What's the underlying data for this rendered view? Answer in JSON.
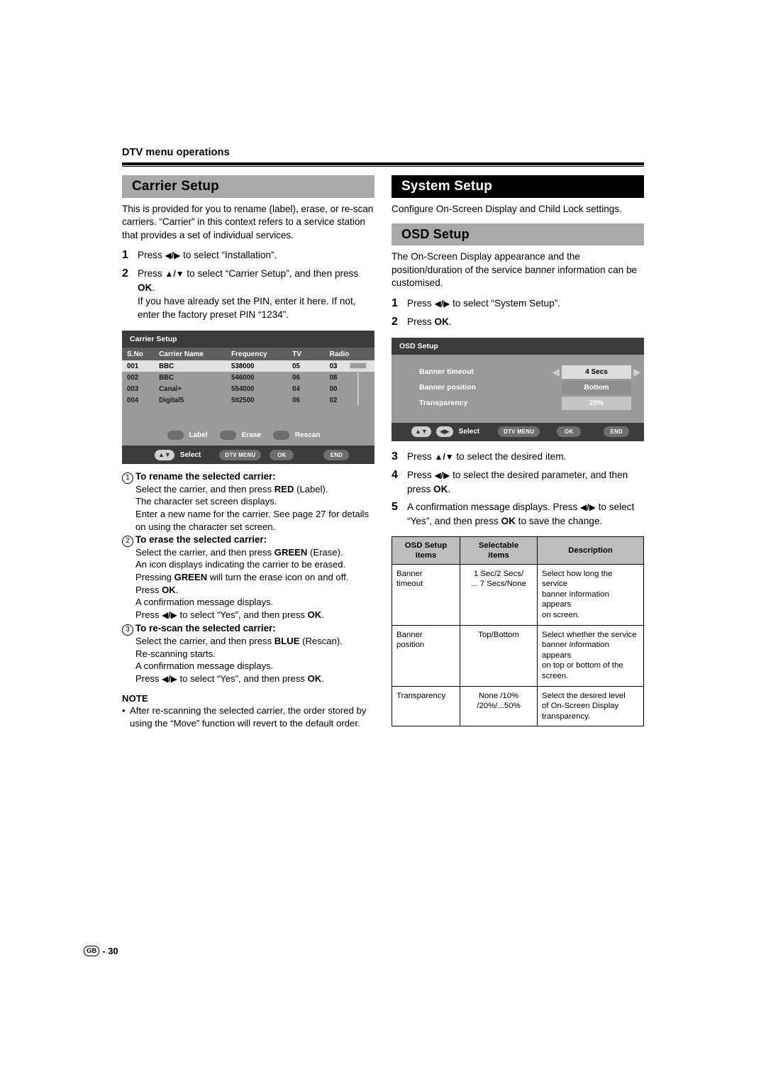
{
  "page": {
    "running_head": "DTV menu operations",
    "footer_region": "GB",
    "footer_page": "- 30"
  },
  "left_column": {
    "section_title": "Carrier Setup",
    "intro": "This is provided for you to rename (label), erase, or re-scan carriers. “Carrier” in this context refers to a service station that provides a set of individual services.",
    "steps": [
      {
        "num": "1",
        "text_before": "Press ",
        "arrows": "◀/▶",
        "text_after": " to select “Installation”."
      },
      {
        "num": "2",
        "text_before": "Press ",
        "arrows": "▲/▼",
        "text_after": " to select “Carrier Setup”, and then press OK.",
        "extra": "If you have already set the PIN, enter it here. If not, enter the factory preset PIN “1234”."
      }
    ],
    "osd": {
      "title": "Carrier Setup",
      "columns": [
        "S.No",
        "Carrier Name",
        "Frequency",
        "TV",
        "Radio"
      ],
      "rows": [
        {
          "sno": "001",
          "name": "BBC",
          "freq": "538000",
          "tv": "05",
          "radio": "03",
          "selected": true
        },
        {
          "sno": "002",
          "name": "BBC",
          "freq": "546000",
          "tv": "06",
          "radio": "08",
          "selected": false
        },
        {
          "sno": "003",
          "name": "Canal+",
          "freq": "554000",
          "tv": "04",
          "radio": "00",
          "selected": false
        },
        {
          "sno": "004",
          "name": "Digital5",
          "freq": "592500",
          "tv": "06",
          "radio": "02",
          "selected": false
        }
      ],
      "color_buttons": [
        "Label",
        "Erase",
        "Rescan"
      ],
      "footer": {
        "select": "Select",
        "dtv_menu": "DTV MENU",
        "ok": "OK",
        "end": "END"
      }
    },
    "procedures": [
      {
        "marker": "1",
        "heading": "To rename the selected carrier:",
        "lines": [
          "Select the carrier, and then press RED (Label).",
          "The character set screen displays.",
          "Enter a new name for the carrier. See page 27 for details on using the character set screen."
        ]
      },
      {
        "marker": "2",
        "heading": "To erase the selected carrier:",
        "lines": [
          "Select the carrier, and then press GREEN (Erase).",
          "An icon displays indicating the carrier to be erased.",
          "Pressing GREEN will turn the erase icon on and off.",
          "Press OK.",
          "A confirmation message displays.",
          "Press ◀/▶ to select “Yes”, and then press OK."
        ]
      },
      {
        "marker": "3",
        "heading": "To re-scan the selected carrier:",
        "lines": [
          "Select the carrier, and then press BLUE (Rescan).",
          "Re-scanning starts.",
          "A confirmation message displays.",
          "Press ◀/▶ to select “Yes”, and then press OK."
        ]
      }
    ],
    "note": {
      "heading": "NOTE",
      "bullet": "•",
      "text": "After re-scanning the selected carrier, the order stored by using the “Move” function will revert to the default order."
    }
  },
  "right_column": {
    "section_title": "System Setup",
    "section_intro": "Configure On-Screen Display and Child Lock settings.",
    "sub_title": "OSD Setup",
    "sub_intro": "The On-Screen Display appearance and the position/duration of the service banner information can be customised.",
    "steps_top": [
      {
        "num": "1",
        "text_before": "Press ",
        "arrows": "◀/▶",
        "text_after": " to select “System Setup”."
      },
      {
        "num": "2",
        "text_before": "Press OK.",
        "arrows": "",
        "text_after": ""
      }
    ],
    "osd": {
      "title": "OSD Setup",
      "rows": [
        {
          "label": "Banner timeout",
          "value": "4 Secs",
          "style": "highlight",
          "arrows": true
        },
        {
          "label": "Banner position",
          "value": "Bottom",
          "style": "mid",
          "arrows": false
        },
        {
          "label": "Transparency",
          "value": "20%",
          "style": "low",
          "arrows": false
        }
      ],
      "arrow_left": "◀",
      "arrow_right": "▶",
      "footer": {
        "select": "Select",
        "dtv_menu": "DTV MENU",
        "ok": "OK",
        "end": "END"
      }
    },
    "steps_bottom": [
      {
        "num": "3",
        "text_before": "Press ",
        "arrows": "▲/▼",
        "text_after": " to select the desired item."
      },
      {
        "num": "4",
        "text_before": "Press ",
        "arrows": "◀/▶",
        "text_after": " to select the desired parameter, and then press OK."
      },
      {
        "num": "5",
        "text_before": "A confirmation message displays. Press ",
        "arrows": "◀/▶",
        "text_after": " to select “Yes”, and then press OK to save the change."
      }
    ],
    "spec_table": {
      "headers": [
        "OSD Setup items",
        "Selectable items",
        "Description"
      ],
      "header_lines": [
        [
          "OSD Setup",
          "items"
        ],
        [
          "Selectable",
          "items"
        ],
        [
          "Description"
        ]
      ],
      "rows": [
        {
          "item": "Banner timeout",
          "item_lines": [
            "Banner",
            "timeout"
          ],
          "selectable": "1 Sec/2 Secs/ ... 7 Secs/None",
          "selectable_lines": [
            "1 Sec/2 Secs/",
            "... 7 Secs/None"
          ],
          "description": "Select how long the service banner information appears on screen.",
          "description_lines": [
            "Select how long the service",
            "banner information appears",
            "on screen."
          ]
        },
        {
          "item": "Banner position",
          "item_lines": [
            "Banner",
            "position"
          ],
          "selectable": "Top/Bottom",
          "selectable_lines": [
            "Top/Bottom"
          ],
          "description": "Select whether the service banner information appears on top or bottom of the screen.",
          "description_lines": [
            "Select whether the service",
            "banner information appears",
            "on top or bottom of the",
            "screen."
          ]
        },
        {
          "item": "Transparency",
          "item_lines": [
            "Transparency"
          ],
          "selectable": "None /10% /20%/...50%",
          "selectable_lines": [
            "None /10%",
            "/20%/...50%"
          ],
          "description": "Select the desired level of On-Screen Display transparency.",
          "description_lines": [
            "Select the desired level",
            "of On-Screen Display",
            "transparency."
          ]
        }
      ]
    }
  },
  "colors": {
    "bar_gray": "#a8a8a8",
    "bar_black": "#000000",
    "osd_title": "#3c3c3c",
    "osd_body": "#9a9a9a",
    "osd_header_row": "#5e5e5e",
    "osd_selected_row": "#e2e2e2",
    "spec_header": "#bdbdbd"
  }
}
